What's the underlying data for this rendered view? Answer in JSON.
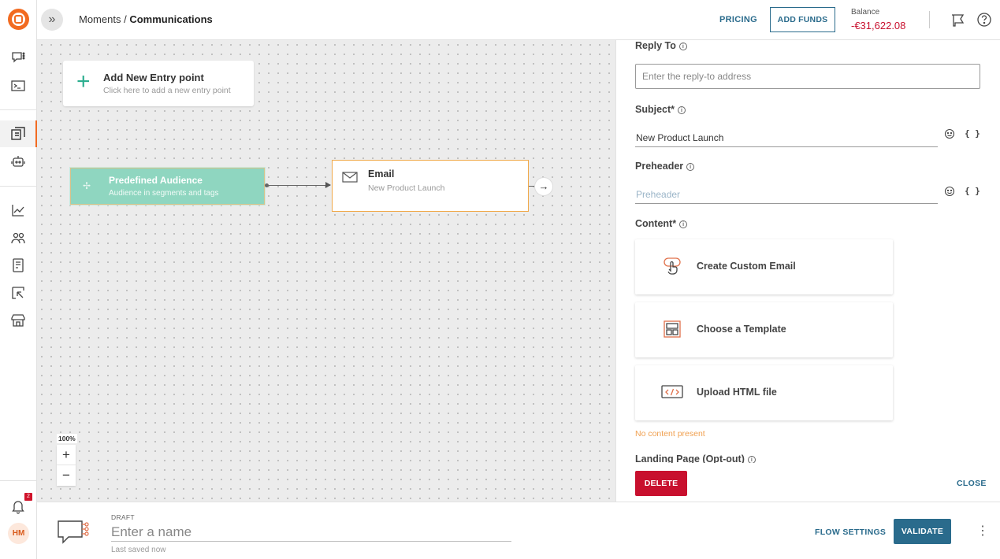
{
  "header": {
    "breadcrumb_parent": "Moments",
    "breadcrumb_sep": " / ",
    "breadcrumb_current": "Communications",
    "pricing_label": "PRICING",
    "add_funds_label": "ADD FUNDS",
    "balance_label": "Balance",
    "balance_value": "-€31,622.08"
  },
  "sidebar": {
    "notification_count": "2",
    "avatar_initials": "HM",
    "icons": [
      "chat-icon",
      "terminal-icon",
      "flows-icon",
      "bot-icon",
      "analytics-icon",
      "people-icon",
      "book-icon",
      "export-icon",
      "store-icon",
      "bell-icon"
    ]
  },
  "canvas": {
    "entry_point": {
      "title": "Add New Entry point",
      "subtitle": "Click here to add a new entry point"
    },
    "audience_node": {
      "title": "Predefined Audience",
      "subtitle": "Audience in segments and tags"
    },
    "email_node": {
      "title": "Email",
      "subtitle": "New Product Launch"
    },
    "zoom_level": "100%",
    "zoom_in": "+",
    "zoom_out": "−"
  },
  "panel": {
    "reply_to_label": "Reply To",
    "reply_to_placeholder": "Enter the reply-to address",
    "subject_label": "Subject*",
    "subject_value": "New Product Launch",
    "preheader_label": "Preheader",
    "preheader_placeholder": "Preheader",
    "content_label": "Content*",
    "content_options": [
      {
        "label": "Create Custom Email",
        "icon": "custom-email-icon"
      },
      {
        "label": "Choose a Template",
        "icon": "template-icon"
      },
      {
        "label": "Upload HTML file",
        "icon": "html-file-icon"
      }
    ],
    "no_content": "No content present",
    "landing_label": "Landing Page (Opt-out)",
    "delete_label": "DELETE",
    "close_label": "CLOSE",
    "braces": "{ }"
  },
  "bottombar": {
    "draft_label": "DRAFT",
    "name_placeholder": "Enter a name",
    "saved_label": "Last saved now",
    "flow_settings_label": "FLOW SETTINGS",
    "validate_label": "VALIDATE",
    "more": "⋮"
  },
  "colors": {
    "brand_orange": "#f26b21",
    "accent_blue": "#2a6b8c",
    "danger_red": "#c8102e",
    "audience_green": "#8fd6c0",
    "email_border": "#f0a94a"
  }
}
